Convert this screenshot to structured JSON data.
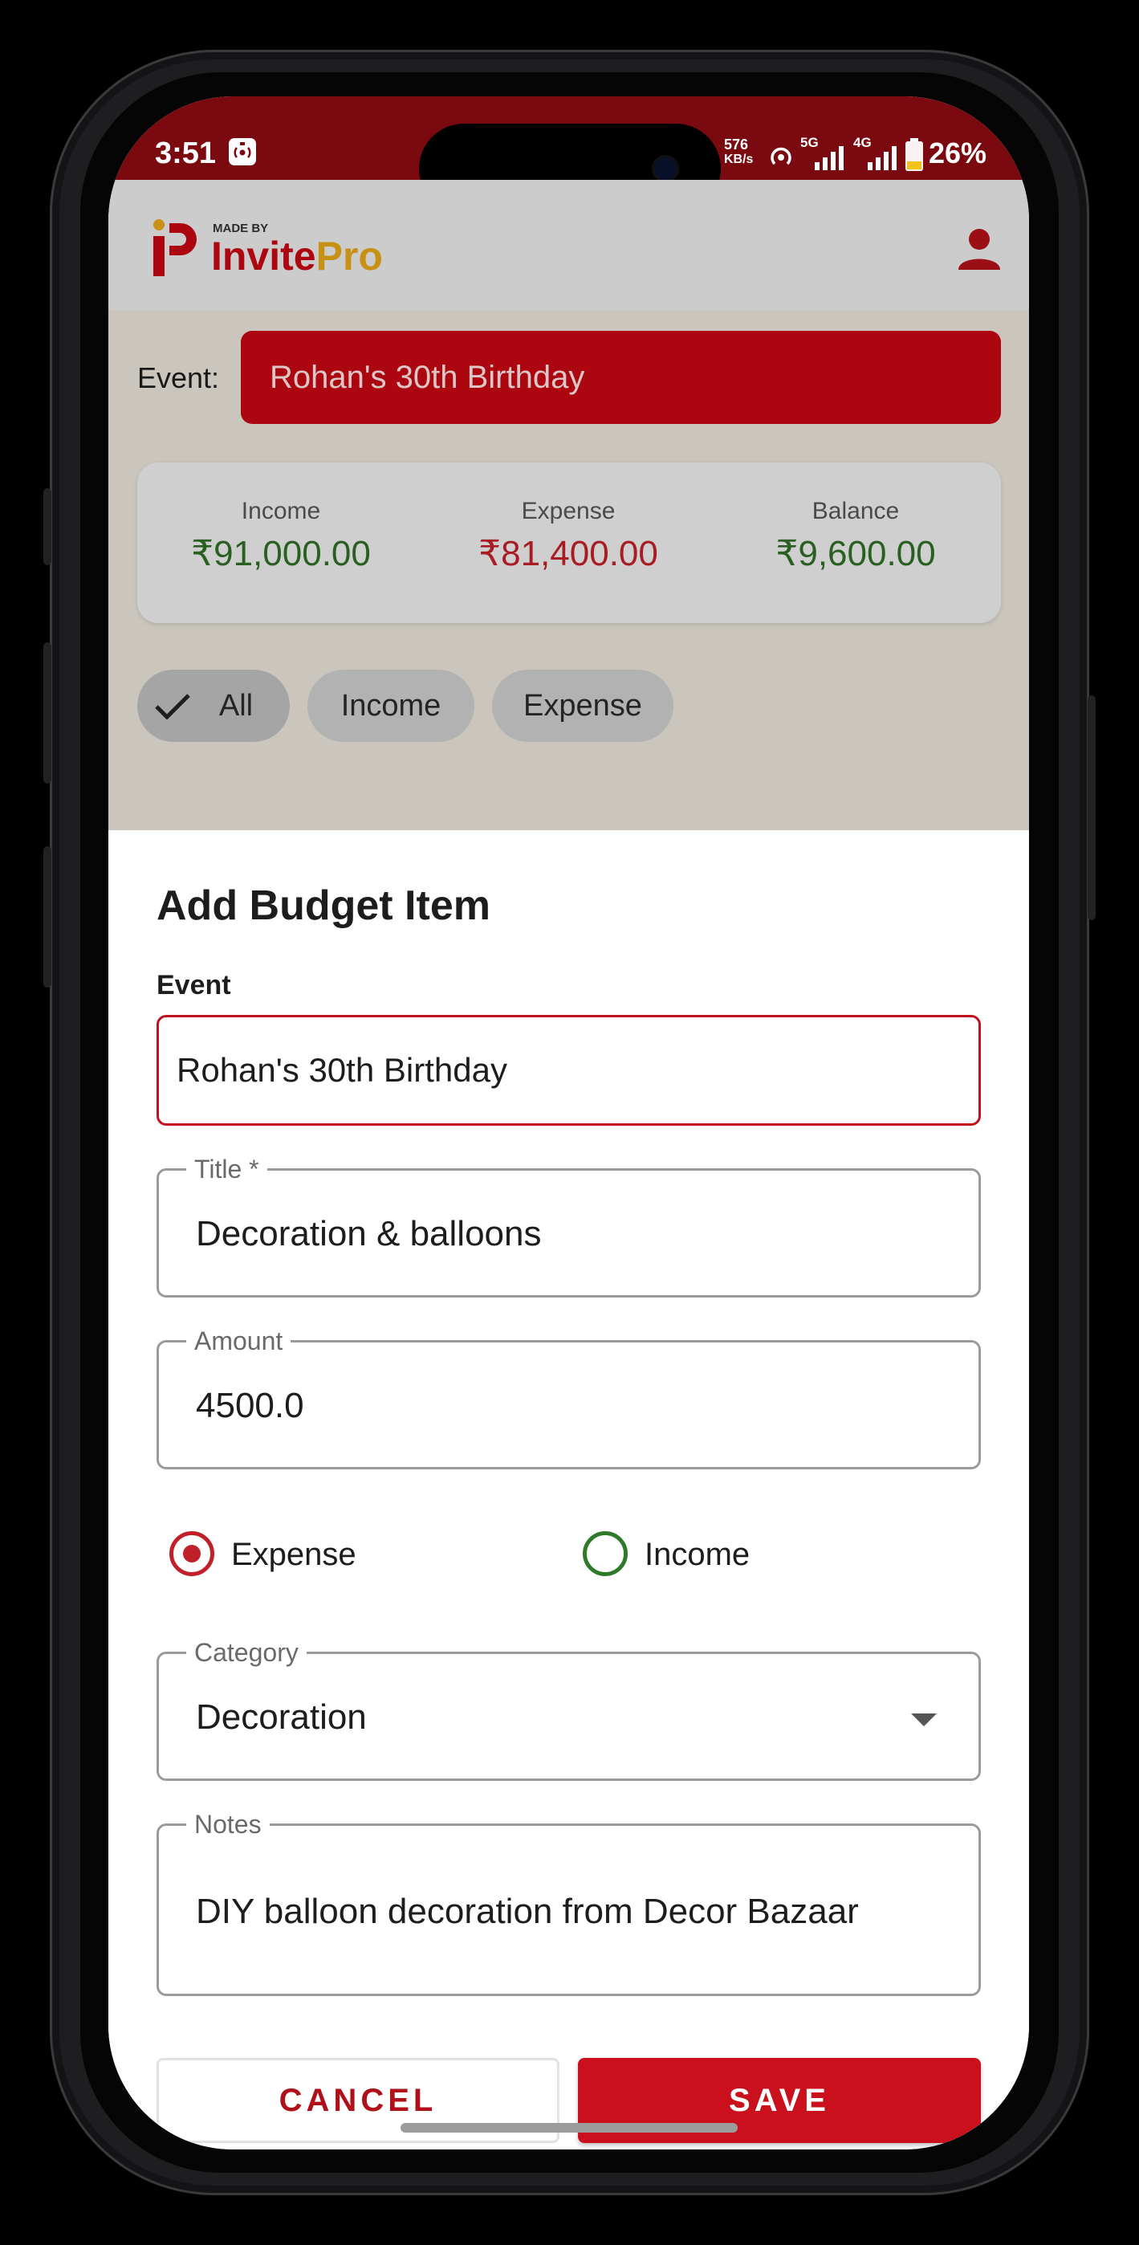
{
  "status_bar": {
    "time": "3:51",
    "net_speed_value": "576",
    "net_speed_unit": "KB/s",
    "network_1": "5G",
    "network_2": "4G",
    "battery": "26%"
  },
  "header": {
    "logo_tagline": "MADE BY",
    "logo_name_1": "Invite",
    "logo_name_2": "Pro"
  },
  "background": {
    "event_label": "Event:",
    "event_selected": "Rohan's 30th Birthday",
    "summary": {
      "income_label": "Income",
      "income_value": "₹91,000.00",
      "expense_label": "Expense",
      "expense_value": "₹81,400.00",
      "balance_label": "Balance",
      "balance_value": "₹9,600.00"
    },
    "filters": [
      "All",
      "Income",
      "Expense"
    ]
  },
  "sheet": {
    "title": "Add Budget Item",
    "event_caption": "Event",
    "event_value": "Rohan's 30th Birthday",
    "title_label": "Title *",
    "title_value": "Decoration & balloons",
    "amount_label": "Amount",
    "amount_value": "4500.0",
    "type_options": [
      "Expense",
      "Income"
    ],
    "type_selected": "Expense",
    "category_label": "Category",
    "category_value": "Decoration",
    "notes_label": "Notes",
    "notes_value": "DIY balloon decoration from Decor Bazaar",
    "cancel_label": "CANCEL",
    "save_label": "SAVE"
  },
  "colors": {
    "brand_red": "#c40814",
    "status_bar": "#7a0a10",
    "income_green": "#2f6e26",
    "expense_red": "#c0202a"
  }
}
